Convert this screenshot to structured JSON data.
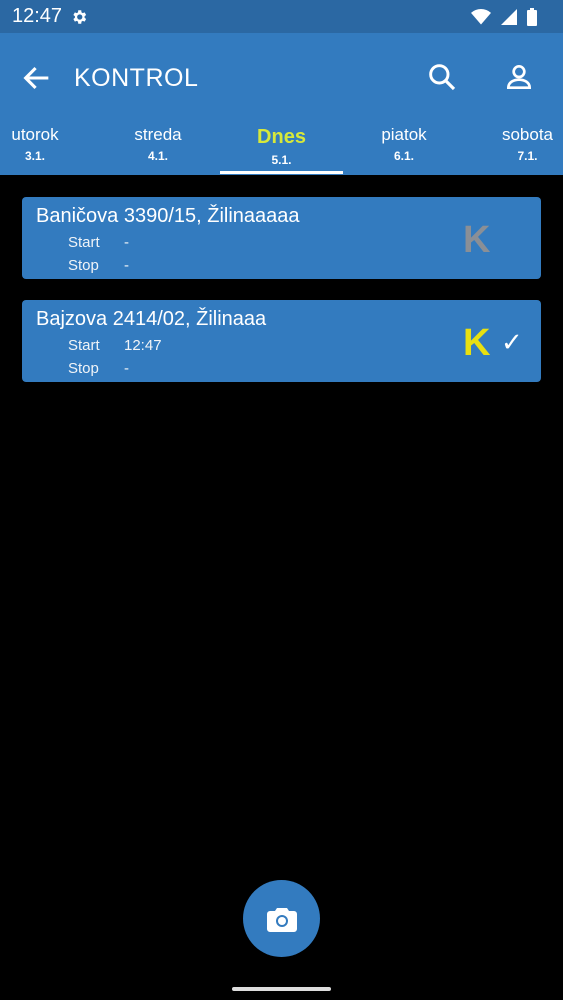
{
  "status": {
    "time": "12:47"
  },
  "appbar": {
    "title": "KONTROL"
  },
  "tabs": [
    {
      "name": "utorok",
      "date": "3.1."
    },
    {
      "name": "streda",
      "date": "4.1."
    },
    {
      "name": "Dnes",
      "date": "5.1."
    },
    {
      "name": "piatok",
      "date": "6.1."
    },
    {
      "name": "sobota",
      "date": "7.1."
    }
  ],
  "colors": {
    "accent": "#337bbf",
    "statusbar": "#2b68a3",
    "active_tab": "#d7e83a",
    "k_inactive": "#8a8f96",
    "k_active": "#e8e010"
  },
  "items": [
    {
      "address": "Baničova 3390/15, Žilinaaaaa",
      "start_label": "Start",
      "start_value": "-",
      "stop_label": "Stop",
      "stop_value": "-",
      "k": "K",
      "k_state": "inactive",
      "check": ""
    },
    {
      "address": "Bajzova 2414/02, Žilinaaa",
      "start_label": "Start",
      "start_value": "12:47",
      "stop_label": "Stop",
      "stop_value": "-",
      "k": "K",
      "k_state": "active",
      "check": "✓"
    }
  ],
  "icons": {
    "settings": "gear-icon",
    "back": "arrow-left-icon",
    "search": "search-icon",
    "user": "user-icon",
    "camera": "camera-icon"
  }
}
